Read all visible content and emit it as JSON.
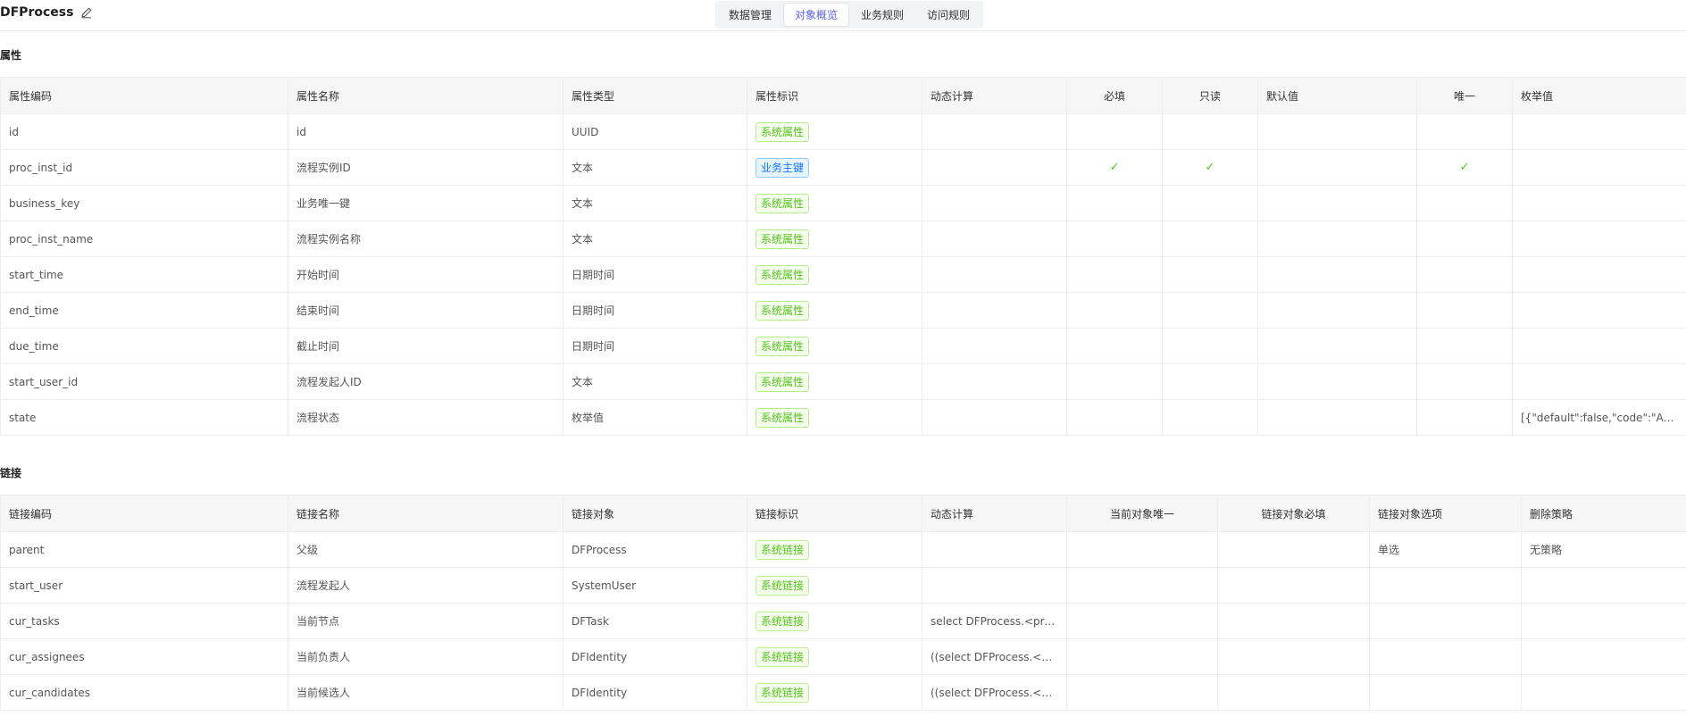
{
  "app": {
    "title": "DFProcess",
    "edit_icon": "edit-icon"
  },
  "tabs": [
    {
      "label": "数据管理",
      "active": false
    },
    {
      "label": "对象概览",
      "active": true
    },
    {
      "label": "业务规则",
      "active": false
    },
    {
      "label": "访问规则",
      "active": false
    }
  ],
  "attributes": {
    "section_title": "属性",
    "headers": [
      "属性编码",
      "属性名称",
      "属性类型",
      "属性标识",
      "动态计算",
      "必填",
      "只读",
      "默认值",
      "唯一",
      "枚举值"
    ],
    "rows": [
      {
        "code": "id",
        "name": "id",
        "type": "UUID",
        "tag": "系统属性",
        "tag_style": "green",
        "dynamic": "",
        "required": false,
        "readonly": false,
        "default": "",
        "unique": false,
        "enum": ""
      },
      {
        "code": "proc_inst_id",
        "name": "流程实例ID",
        "type": "文本",
        "tag": "业务主键",
        "tag_style": "blue",
        "dynamic": "",
        "required": true,
        "readonly": true,
        "default": "",
        "unique": true,
        "enum": ""
      },
      {
        "code": "business_key",
        "name": "业务唯一键",
        "type": "文本",
        "tag": "系统属性",
        "tag_style": "green",
        "dynamic": "",
        "required": false,
        "readonly": false,
        "default": "",
        "unique": false,
        "enum": ""
      },
      {
        "code": "proc_inst_name",
        "name": "流程实例名称",
        "type": "文本",
        "tag": "系统属性",
        "tag_style": "green",
        "dynamic": "",
        "required": false,
        "readonly": false,
        "default": "",
        "unique": false,
        "enum": ""
      },
      {
        "code": "start_time",
        "name": "开始时间",
        "type": "日期时间",
        "tag": "系统属性",
        "tag_style": "green",
        "dynamic": "",
        "required": false,
        "readonly": false,
        "default": "",
        "unique": false,
        "enum": ""
      },
      {
        "code": "end_time",
        "name": "结束时间",
        "type": "日期时间",
        "tag": "系统属性",
        "tag_style": "green",
        "dynamic": "",
        "required": false,
        "readonly": false,
        "default": "",
        "unique": false,
        "enum": ""
      },
      {
        "code": "due_time",
        "name": "截止时间",
        "type": "日期时间",
        "tag": "系统属性",
        "tag_style": "green",
        "dynamic": "",
        "required": false,
        "readonly": false,
        "default": "",
        "unique": false,
        "enum": ""
      },
      {
        "code": "start_user_id",
        "name": "流程发起人ID",
        "type": "文本",
        "tag": "系统属性",
        "tag_style": "green",
        "dynamic": "",
        "required": false,
        "readonly": false,
        "default": "",
        "unique": false,
        "enum": ""
      },
      {
        "code": "state",
        "name": "流程状态",
        "type": "枚举值",
        "tag": "系统属性",
        "tag_style": "green",
        "dynamic": "",
        "required": false,
        "readonly": false,
        "default": "",
        "unique": false,
        "enum": "[{\"default\":false,\"code\":\"ACTI..."
      }
    ]
  },
  "links": {
    "section_title": "链接",
    "headers": [
      "链接编码",
      "链接名称",
      "链接对象",
      "链接标识",
      "动态计算",
      "当前对象唯一",
      "链接对象必填",
      "链接对象选项",
      "删除策略"
    ],
    "rows": [
      {
        "code": "parent",
        "name": "父级",
        "target": "DFProcess",
        "tag": "系统链接",
        "dynamic": "",
        "cur_unique": "",
        "target_required": "",
        "option": "单选",
        "delete_policy": "无策略"
      },
      {
        "code": "start_user",
        "name": "流程发起人",
        "target": "SystemUser",
        "tag": "系统链接",
        "dynamic": "",
        "cur_unique": "",
        "target_required": "",
        "option": "",
        "delete_policy": ""
      },
      {
        "code": "cur_tasks",
        "name": "当前节点",
        "target": "DFTask",
        "tag": "系统链接",
        "dynamic": "select DFProcess.<proces...",
        "cur_unique": "",
        "target_required": "",
        "option": "",
        "delete_policy": ""
      },
      {
        "code": "cur_assignees",
        "name": "当前负责人",
        "target": "DFIdentity",
        "tag": "系统链接",
        "dynamic": "((select DFProcess.<proc...",
        "cur_unique": "",
        "target_required": "",
        "option": "",
        "delete_policy": ""
      },
      {
        "code": "cur_candidates",
        "name": "当前候选人",
        "target": "DFIdentity",
        "tag": "系统链接",
        "dynamic": "((select DFProcess.<proc...",
        "cur_unique": "",
        "target_required": "",
        "option": "",
        "delete_policy": ""
      }
    ]
  },
  "check_icon": "checkmark-icon",
  "colors": {
    "accent": "#5b63e8",
    "tag_green": "#52c41a",
    "tag_blue": "#1677ff"
  }
}
